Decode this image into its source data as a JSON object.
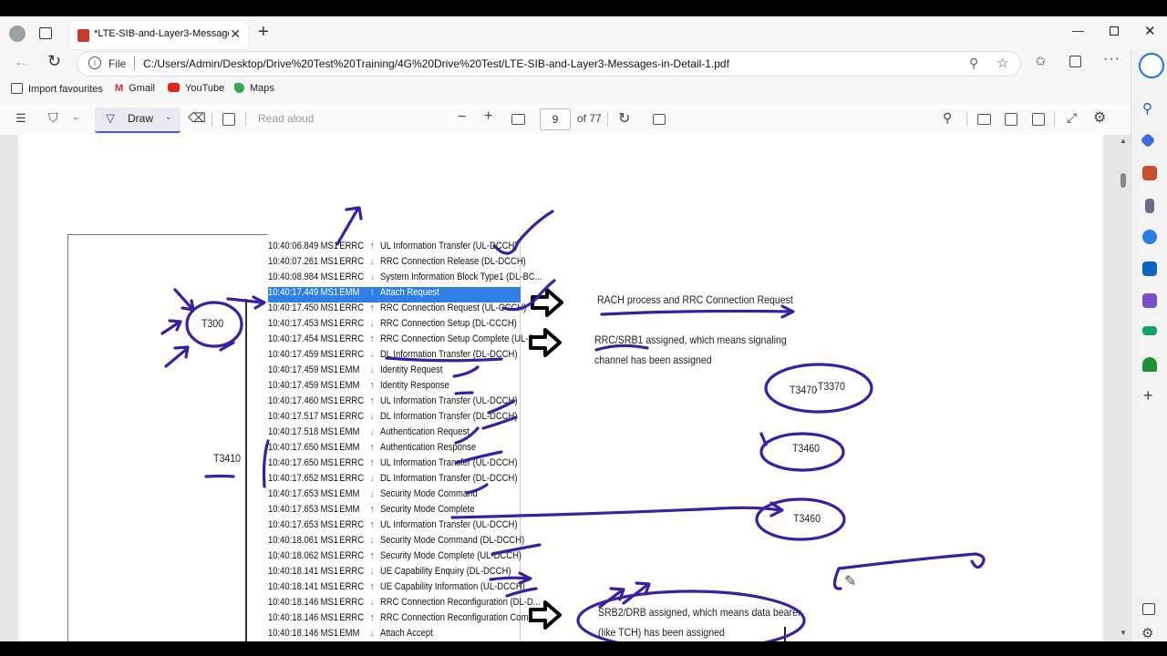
{
  "browser": {
    "tab_title": "*LTE-SIB-and-Layer3-Messages-in-Detail-1.pdf",
    "url_label": "File",
    "url": "C:/Users/Admin/Desktop/Drive%20Test%20Training/4G%20Drive%20Test/LTE-SIB-and-Layer3-Messages-in-Detail-1.pdf"
  },
  "favourites": [
    {
      "label": "Import favourites",
      "icon": "import-icon"
    },
    {
      "label": "Gmail",
      "icon": "gmail-icon"
    },
    {
      "label": "YouTube",
      "icon": "youtube-icon"
    },
    {
      "label": "Maps",
      "icon": "maps-icon"
    }
  ],
  "pdf_toolbar": {
    "draw_label": "Draw",
    "read_aloud_label": "Read aloud",
    "page_number": "9",
    "page_total": "of 77"
  },
  "log": [
    {
      "time": "10:40:06.849",
      "ms": "MS1",
      "proto": "ERRC",
      "dir": "up",
      "msg": "UL Information Transfer (UL-DCCH)"
    },
    {
      "time": "10:40:07.261",
      "ms": "MS1",
      "proto": "ERRC",
      "dir": "down",
      "msg": "RRC Connection Release (DL-DCCH)"
    },
    {
      "time": "10:40:08.984",
      "ms": "MS1",
      "proto": "ERRC",
      "dir": "down",
      "msg": "System Information Block Type1 (DL-BC..."
    },
    {
      "time": "10:40:17.449",
      "ms": "MS1",
      "proto": "EMM",
      "dir": "up",
      "msg": "Attach Request",
      "selected": true
    },
    {
      "time": "10:40:17.450",
      "ms": "MS1",
      "proto": "ERRC",
      "dir": "up",
      "msg": "RRC Connection Request (UL-CCCH)"
    },
    {
      "time": "10:40:17.453",
      "ms": "MS1",
      "proto": "ERRC",
      "dir": "down",
      "msg": "RRC Connection Setup (DL-CCCH)"
    },
    {
      "time": "10:40:17.454",
      "ms": "MS1",
      "proto": "ERRC",
      "dir": "up",
      "msg": "RRC Connection Setup Complete (UL-D..."
    },
    {
      "time": "10:40:17.459",
      "ms": "MS1",
      "proto": "ERRC",
      "dir": "down",
      "msg": "DL Information Transfer (DL-DCCH)"
    },
    {
      "time": "10:40:17.459",
      "ms": "MS1",
      "proto": "EMM",
      "dir": "down",
      "msg": "Identity Request"
    },
    {
      "time": "10:40:17.459",
      "ms": "MS1",
      "proto": "EMM",
      "dir": "up",
      "msg": "Identity Response"
    },
    {
      "time": "10:40:17.460",
      "ms": "MS1",
      "proto": "ERRC",
      "dir": "up",
      "msg": "UL Information Transfer (UL-DCCH)"
    },
    {
      "time": "10:40:17.517",
      "ms": "MS1",
      "proto": "ERRC",
      "dir": "down",
      "msg": "DL Information Transfer (DL-DCCH)"
    },
    {
      "time": "10:40:17.518",
      "ms": "MS1",
      "proto": "EMM",
      "dir": "down",
      "msg": "Authentication Request"
    },
    {
      "time": "10:40:17.650",
      "ms": "MS1",
      "proto": "EMM",
      "dir": "up",
      "msg": "Authentication Response"
    },
    {
      "time": "10:40:17.650",
      "ms": "MS1",
      "proto": "ERRC",
      "dir": "up",
      "msg": "UL Information Transfer (UL-DCCH)"
    },
    {
      "time": "10:40:17.652",
      "ms": "MS1",
      "proto": "ERRC",
      "dir": "down",
      "msg": "DL Information Transfer (DL-DCCH)"
    },
    {
      "time": "10:40:17.653",
      "ms": "MS1",
      "proto": "EMM",
      "dir": "down",
      "msg": "Security Mode Command"
    },
    {
      "time": "10:40:17.653",
      "ms": "MS1",
      "proto": "EMM",
      "dir": "up",
      "msg": "Security Mode Complete"
    },
    {
      "time": "10:40:17.653",
      "ms": "MS1",
      "proto": "ERRC",
      "dir": "up",
      "msg": "UL Information Transfer (UL-DCCH)"
    },
    {
      "time": "10:40:18.061",
      "ms": "MS1",
      "proto": "ERRC",
      "dir": "down",
      "msg": "Security Mode Command (DL-DCCH)"
    },
    {
      "time": "10:40:18.062",
      "ms": "MS1",
      "proto": "ERRC",
      "dir": "up",
      "msg": "Security Mode Complete (UL-DCCH)"
    },
    {
      "time": "10:40:18.141",
      "ms": "MS1",
      "proto": "ERRC",
      "dir": "down",
      "msg": "UE Capability Enquiry (DL-DCCH)"
    },
    {
      "time": "10:40:18.141",
      "ms": "MS1",
      "proto": "ERRC",
      "dir": "up",
      "msg": "UE Capability Information (UL-DCCH)"
    },
    {
      "time": "10:40:18.146",
      "ms": "MS1",
      "proto": "ERRC",
      "dir": "down",
      "msg": "RRC Connection Reconfiguration (DL-D..."
    },
    {
      "time": "10:40:18.146",
      "ms": "MS1",
      "proto": "ERRC",
      "dir": "up",
      "msg": "RRC Connection Reconfiguration Compl..."
    },
    {
      "time": "10:40:18.146",
      "ms": "MS1",
      "proto": "EMM",
      "dir": "down",
      "msg": "Attach Accept"
    }
  ],
  "notes": {
    "rach": "RACH process and RRC Connection Request",
    "srb1_line1": "RRC/SRB1 assigned, which means signaling",
    "srb1_line2": "channel has been assigned",
    "srb2_line1": "SRB2/DRB assigned, which means data bearer",
    "srb2_line2": "(like TCH) has been assigned"
  },
  "timers": {
    "t300": "T300",
    "t3410": "T3410",
    "t3470": "T3470",
    "t3370": ",T3370",
    "t3460_a": "T3460",
    "t3460_b": "T3460"
  }
}
